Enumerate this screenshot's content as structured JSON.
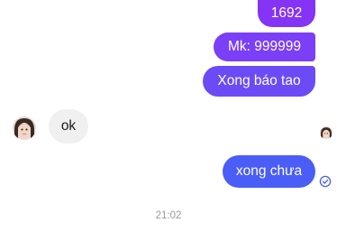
{
  "conversation": {
    "sent_messages": [
      {
        "text": "1692"
      },
      {
        "text": "Mk: 999999"
      },
      {
        "text": "Xong báo tao"
      },
      {
        "text": "xong chưa"
      }
    ],
    "received_message": {
      "text": "ok"
    },
    "timestamp": "21:02",
    "icons": {
      "contact_avatar": "contact-avatar",
      "seen_avatar": "seen-receipt-avatar",
      "delivered": "check-circle-icon"
    },
    "colors": {
      "bubble_1": "#8534f5",
      "bubble_2": "#7a3ff6",
      "bubble_3": "#6c4bf7",
      "bubble_4": "#4a5df6",
      "received_bg": "#f0f0f0"
    }
  }
}
